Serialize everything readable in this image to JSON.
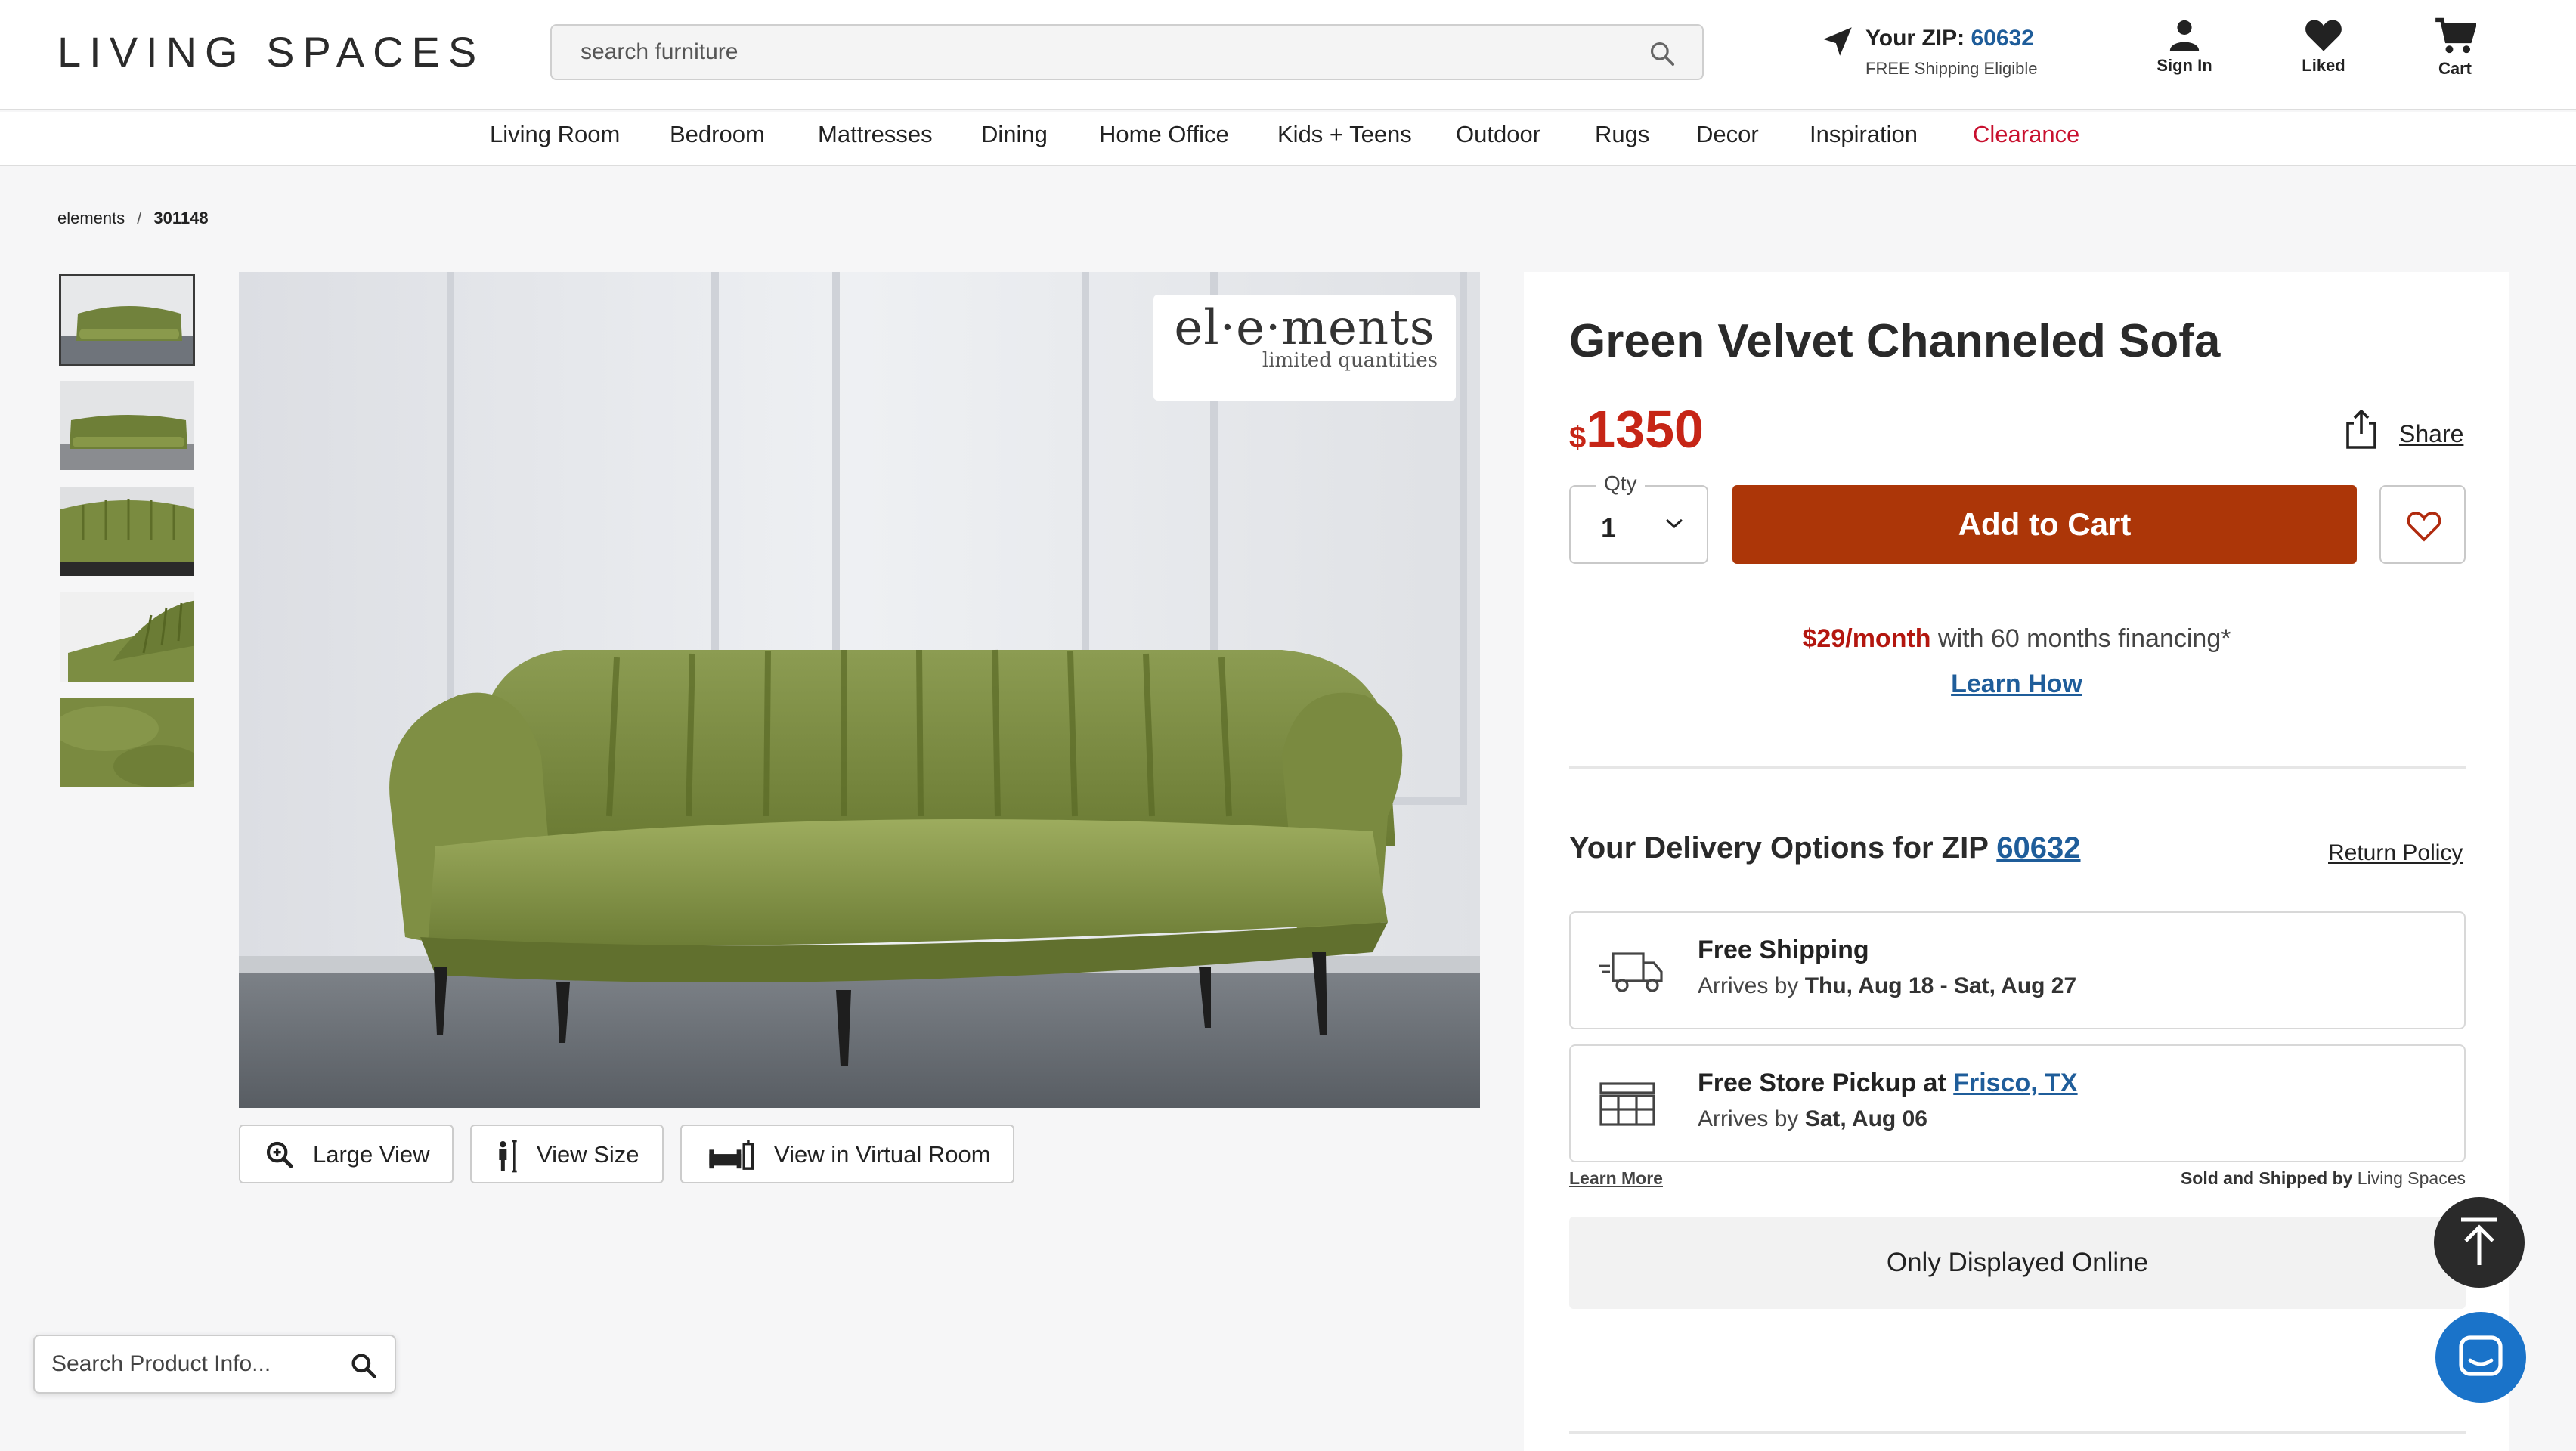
{
  "header": {
    "logo": "LIVING SPACES",
    "search_placeholder": "search furniture",
    "zip_label": "Your ZIP:",
    "zip": "60632",
    "zip_sub": "FREE Shipping Eligible",
    "sign_in": "Sign In",
    "liked": "Liked",
    "cart": "Cart"
  },
  "nav": [
    "Living Room",
    "Bedroom",
    "Mattresses",
    "Dining",
    "Home Office",
    "Kids + Teens",
    "Outdoor",
    "Rugs",
    "Decor",
    "Inspiration",
    "Clearance"
  ],
  "breadcrumb": {
    "parent": "elements",
    "sep": "/",
    "current": "301148"
  },
  "gallery": {
    "thumbnail_count": 5,
    "active_thumbnail": 1,
    "badge_brand": "el·e·ments",
    "badge_sub": "limited quantities",
    "buttons": {
      "large_view": "Large View",
      "view_size": "View Size",
      "virtual_room": "View in Virtual Room"
    }
  },
  "product_search_placeholder": "Search Product Info...",
  "product": {
    "title": "Green Velvet Channeled Sofa",
    "currency": "$",
    "price": "1350",
    "share": "Share",
    "qty_label": "Qty",
    "qty_value": "1",
    "add_to_cart": "Add to Cart",
    "financing_amount": "$29/month",
    "financing_text": " with 60 months financing*",
    "learn_how": "Learn How"
  },
  "delivery": {
    "title": "Your Delivery Options for ZIP ",
    "zip": "60632",
    "return_policy": "Return Policy",
    "ship_title": "Free Shipping",
    "ship_prefix": "Arrives by ",
    "ship_dates": "Thu, Aug 18 - Sat, Aug 27",
    "pickup_title": "Free Store Pickup at ",
    "pickup_store": "Frisco, TX",
    "pickup_prefix": "Arrives by ",
    "pickup_date": "Sat, Aug 06",
    "learn_more": "Learn More",
    "sold_by_label": "Sold and Shipped by",
    "sold_by": " Living Spaces",
    "only_online": "Only Displayed Online"
  },
  "colors": {
    "price_red": "#c62516",
    "cart_button": "#ac3608",
    "link_blue": "#1f5d9a",
    "clearance": "#c8102e",
    "sofa_green": "#7f8f45"
  }
}
